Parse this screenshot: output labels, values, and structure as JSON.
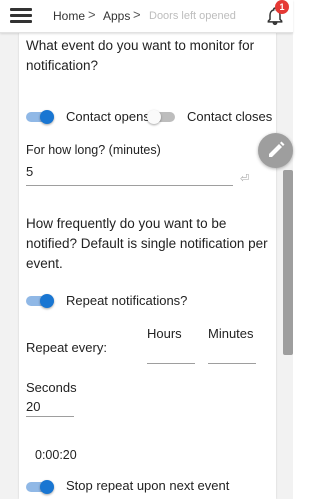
{
  "header": {
    "breadcrumb": [
      "Home",
      "Apps",
      "Doors left opened"
    ],
    "separator": ">",
    "notification_count": "1"
  },
  "form": {
    "question_event": "What event do you want to monitor for notification?",
    "contact_opens": {
      "label": "Contact opens",
      "on": true
    },
    "contact_closes": {
      "label": "Contact closes",
      "on": false
    },
    "duration": {
      "label": "For how long? (minutes)",
      "value": "5"
    },
    "question_frequency": "How frequently do you want to be notified?  Default is single notification per event.",
    "repeat_notifications": {
      "label": "Repeat notifications?",
      "on": true
    },
    "repeat_every": {
      "label": "Repeat every:",
      "hours_label": "Hours",
      "hours_value": "",
      "minutes_label": "Minutes",
      "minutes_value": "",
      "seconds_label": "Seconds",
      "seconds_value": "20"
    },
    "computed_interval": "0:00:20",
    "stop_repeat": {
      "label": "Stop repeat upon next event",
      "on": true
    }
  },
  "colors": {
    "accent": "#1976d2",
    "badge": "#e53935",
    "fab": "#9e9e9e"
  },
  "icons": [
    "menu-icon",
    "bell-icon",
    "pencil-icon",
    "enter-key-icon"
  ]
}
